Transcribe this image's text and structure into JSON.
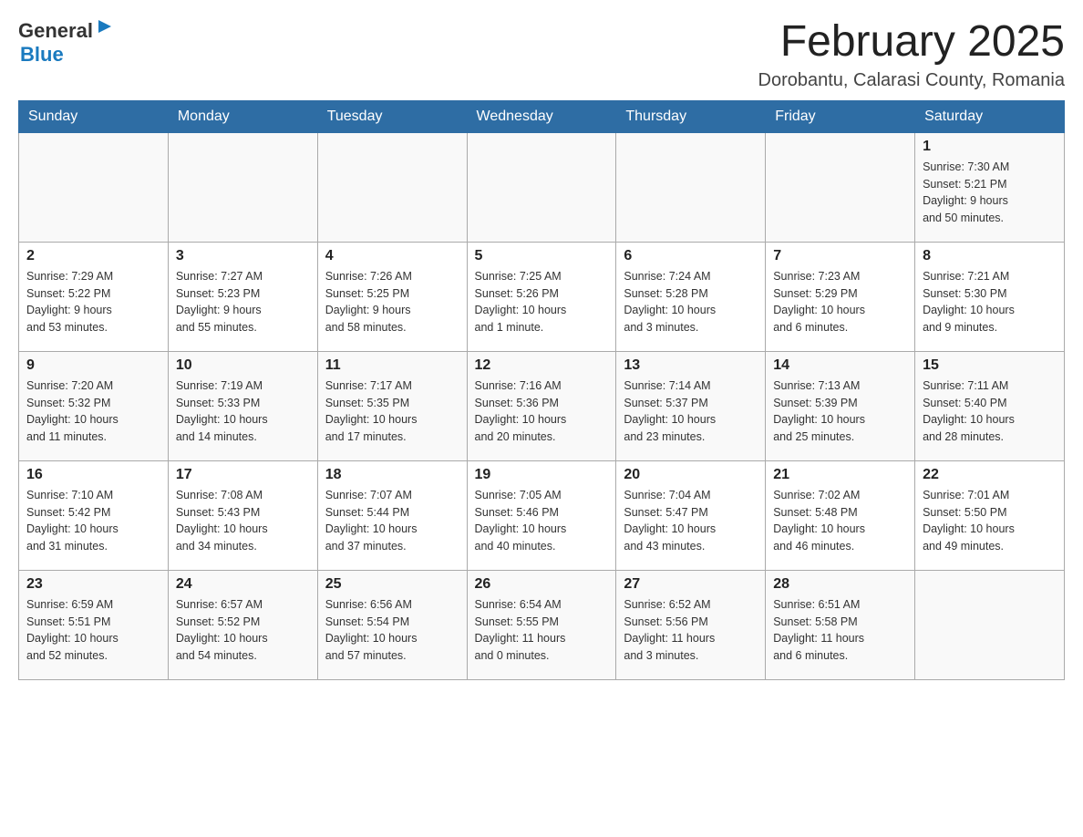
{
  "header": {
    "logo_general": "General",
    "logo_blue": "Blue",
    "title": "February 2025",
    "subtitle": "Dorobantu, Calarasi County, Romania"
  },
  "weekdays": [
    "Sunday",
    "Monday",
    "Tuesday",
    "Wednesday",
    "Thursday",
    "Friday",
    "Saturday"
  ],
  "weeks": [
    [
      {
        "day": "",
        "info": ""
      },
      {
        "day": "",
        "info": ""
      },
      {
        "day": "",
        "info": ""
      },
      {
        "day": "",
        "info": ""
      },
      {
        "day": "",
        "info": ""
      },
      {
        "day": "",
        "info": ""
      },
      {
        "day": "1",
        "info": "Sunrise: 7:30 AM\nSunset: 5:21 PM\nDaylight: 9 hours\nand 50 minutes."
      }
    ],
    [
      {
        "day": "2",
        "info": "Sunrise: 7:29 AM\nSunset: 5:22 PM\nDaylight: 9 hours\nand 53 minutes."
      },
      {
        "day": "3",
        "info": "Sunrise: 7:27 AM\nSunset: 5:23 PM\nDaylight: 9 hours\nand 55 minutes."
      },
      {
        "day": "4",
        "info": "Sunrise: 7:26 AM\nSunset: 5:25 PM\nDaylight: 9 hours\nand 58 minutes."
      },
      {
        "day": "5",
        "info": "Sunrise: 7:25 AM\nSunset: 5:26 PM\nDaylight: 10 hours\nand 1 minute."
      },
      {
        "day": "6",
        "info": "Sunrise: 7:24 AM\nSunset: 5:28 PM\nDaylight: 10 hours\nand 3 minutes."
      },
      {
        "day": "7",
        "info": "Sunrise: 7:23 AM\nSunset: 5:29 PM\nDaylight: 10 hours\nand 6 minutes."
      },
      {
        "day": "8",
        "info": "Sunrise: 7:21 AM\nSunset: 5:30 PM\nDaylight: 10 hours\nand 9 minutes."
      }
    ],
    [
      {
        "day": "9",
        "info": "Sunrise: 7:20 AM\nSunset: 5:32 PM\nDaylight: 10 hours\nand 11 minutes."
      },
      {
        "day": "10",
        "info": "Sunrise: 7:19 AM\nSunset: 5:33 PM\nDaylight: 10 hours\nand 14 minutes."
      },
      {
        "day": "11",
        "info": "Sunrise: 7:17 AM\nSunset: 5:35 PM\nDaylight: 10 hours\nand 17 minutes."
      },
      {
        "day": "12",
        "info": "Sunrise: 7:16 AM\nSunset: 5:36 PM\nDaylight: 10 hours\nand 20 minutes."
      },
      {
        "day": "13",
        "info": "Sunrise: 7:14 AM\nSunset: 5:37 PM\nDaylight: 10 hours\nand 23 minutes."
      },
      {
        "day": "14",
        "info": "Sunrise: 7:13 AM\nSunset: 5:39 PM\nDaylight: 10 hours\nand 25 minutes."
      },
      {
        "day": "15",
        "info": "Sunrise: 7:11 AM\nSunset: 5:40 PM\nDaylight: 10 hours\nand 28 minutes."
      }
    ],
    [
      {
        "day": "16",
        "info": "Sunrise: 7:10 AM\nSunset: 5:42 PM\nDaylight: 10 hours\nand 31 minutes."
      },
      {
        "day": "17",
        "info": "Sunrise: 7:08 AM\nSunset: 5:43 PM\nDaylight: 10 hours\nand 34 minutes."
      },
      {
        "day": "18",
        "info": "Sunrise: 7:07 AM\nSunset: 5:44 PM\nDaylight: 10 hours\nand 37 minutes."
      },
      {
        "day": "19",
        "info": "Sunrise: 7:05 AM\nSunset: 5:46 PM\nDaylight: 10 hours\nand 40 minutes."
      },
      {
        "day": "20",
        "info": "Sunrise: 7:04 AM\nSunset: 5:47 PM\nDaylight: 10 hours\nand 43 minutes."
      },
      {
        "day": "21",
        "info": "Sunrise: 7:02 AM\nSunset: 5:48 PM\nDaylight: 10 hours\nand 46 minutes."
      },
      {
        "day": "22",
        "info": "Sunrise: 7:01 AM\nSunset: 5:50 PM\nDaylight: 10 hours\nand 49 minutes."
      }
    ],
    [
      {
        "day": "23",
        "info": "Sunrise: 6:59 AM\nSunset: 5:51 PM\nDaylight: 10 hours\nand 52 minutes."
      },
      {
        "day": "24",
        "info": "Sunrise: 6:57 AM\nSunset: 5:52 PM\nDaylight: 10 hours\nand 54 minutes."
      },
      {
        "day": "25",
        "info": "Sunrise: 6:56 AM\nSunset: 5:54 PM\nDaylight: 10 hours\nand 57 minutes."
      },
      {
        "day": "26",
        "info": "Sunrise: 6:54 AM\nSunset: 5:55 PM\nDaylight: 11 hours\nand 0 minutes."
      },
      {
        "day": "27",
        "info": "Sunrise: 6:52 AM\nSunset: 5:56 PM\nDaylight: 11 hours\nand 3 minutes."
      },
      {
        "day": "28",
        "info": "Sunrise: 6:51 AM\nSunset: 5:58 PM\nDaylight: 11 hours\nand 6 minutes."
      },
      {
        "day": "",
        "info": ""
      }
    ]
  ]
}
